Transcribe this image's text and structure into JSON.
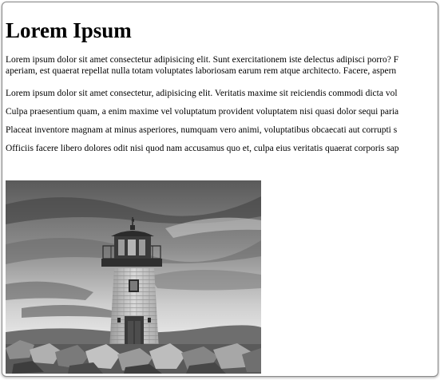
{
  "page": {
    "title": "Lorem Ipsum",
    "paragraphs": [
      {
        "line1": "Lorem ipsum dolor sit amet consectetur adipisicing elit. Sunt exercitationem iste delectus adipisci porro? F",
        "line2": "aperiam, est quaerat repellat nulla totam voluptates laboriosam earum rem atque architecto. Facere, aspern"
      },
      "Lorem ipsum dolor sit amet consectetur, adipisicing elit. Veritatis maxime sit reiciendis commodi dicta vol",
      "Culpa praesentium quam, a enim maxime vel voluptatum provident voluptatem nisi quasi dolor sequi paria",
      "Placeat inventore magnam at minus asperiores, numquam vero animi, voluptatibus obcaecati aut corrupti s",
      "Officiis facere libero dolores odit nisi quod nam accusamus quo et, culpa eius veritatis quaerat corporis sap"
    ],
    "image_subject": "lighthouse-photo"
  }
}
